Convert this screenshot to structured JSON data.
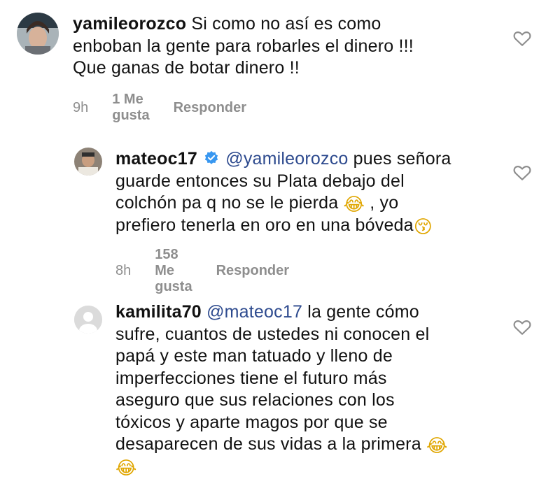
{
  "comments": [
    {
      "username": "yamileorozco",
      "text_lines": [
        "Si como no así es como",
        "enboban la gente para robarles el dinero !!!",
        "Que ganas de botar dinero !!"
      ],
      "time": "9h",
      "likes": "1 Me gusta",
      "reply": "Responder",
      "avatar_icon": "user-photo",
      "like_icon": "heart-outline-icon"
    },
    {
      "username": "mateoc17",
      "verified": true,
      "mention": "@yamileorozco",
      "text_first": " pues señora",
      "text_lines": [
        "guarde entonces su Plata debajo del",
        "colchón pa q no se le pierda",
        " , yo",
        "prefiero tenerla en oro en una bóveda"
      ],
      "emoji_laugh": "😂",
      "emoji_kiss": "😚",
      "time": "8h",
      "likes": "158 Me gusta",
      "reply": "Responder",
      "like_icon": "heart-outline-icon"
    },
    {
      "username": "kamilita70",
      "mention": "@mateoc17",
      "text_first": " la gente cómo",
      "text_lines": [
        "sufre, cuantos de ustedes ni conocen el",
        "papá  y este man tatuado y lleno de",
        "imperfecciones tiene el futuro más",
        "aseguro que sus relaciones con los",
        "tóxicos y aparte magos por que se",
        "desaparecen de sus vidas a la primera"
      ],
      "emoji_laugh": "😂",
      "like_icon": "heart-outline-icon"
    }
  ],
  "colors": {
    "text": "#111111",
    "meta": "#8e8e8e",
    "mention": "#2d4a8e",
    "verified": "#3897f0"
  }
}
